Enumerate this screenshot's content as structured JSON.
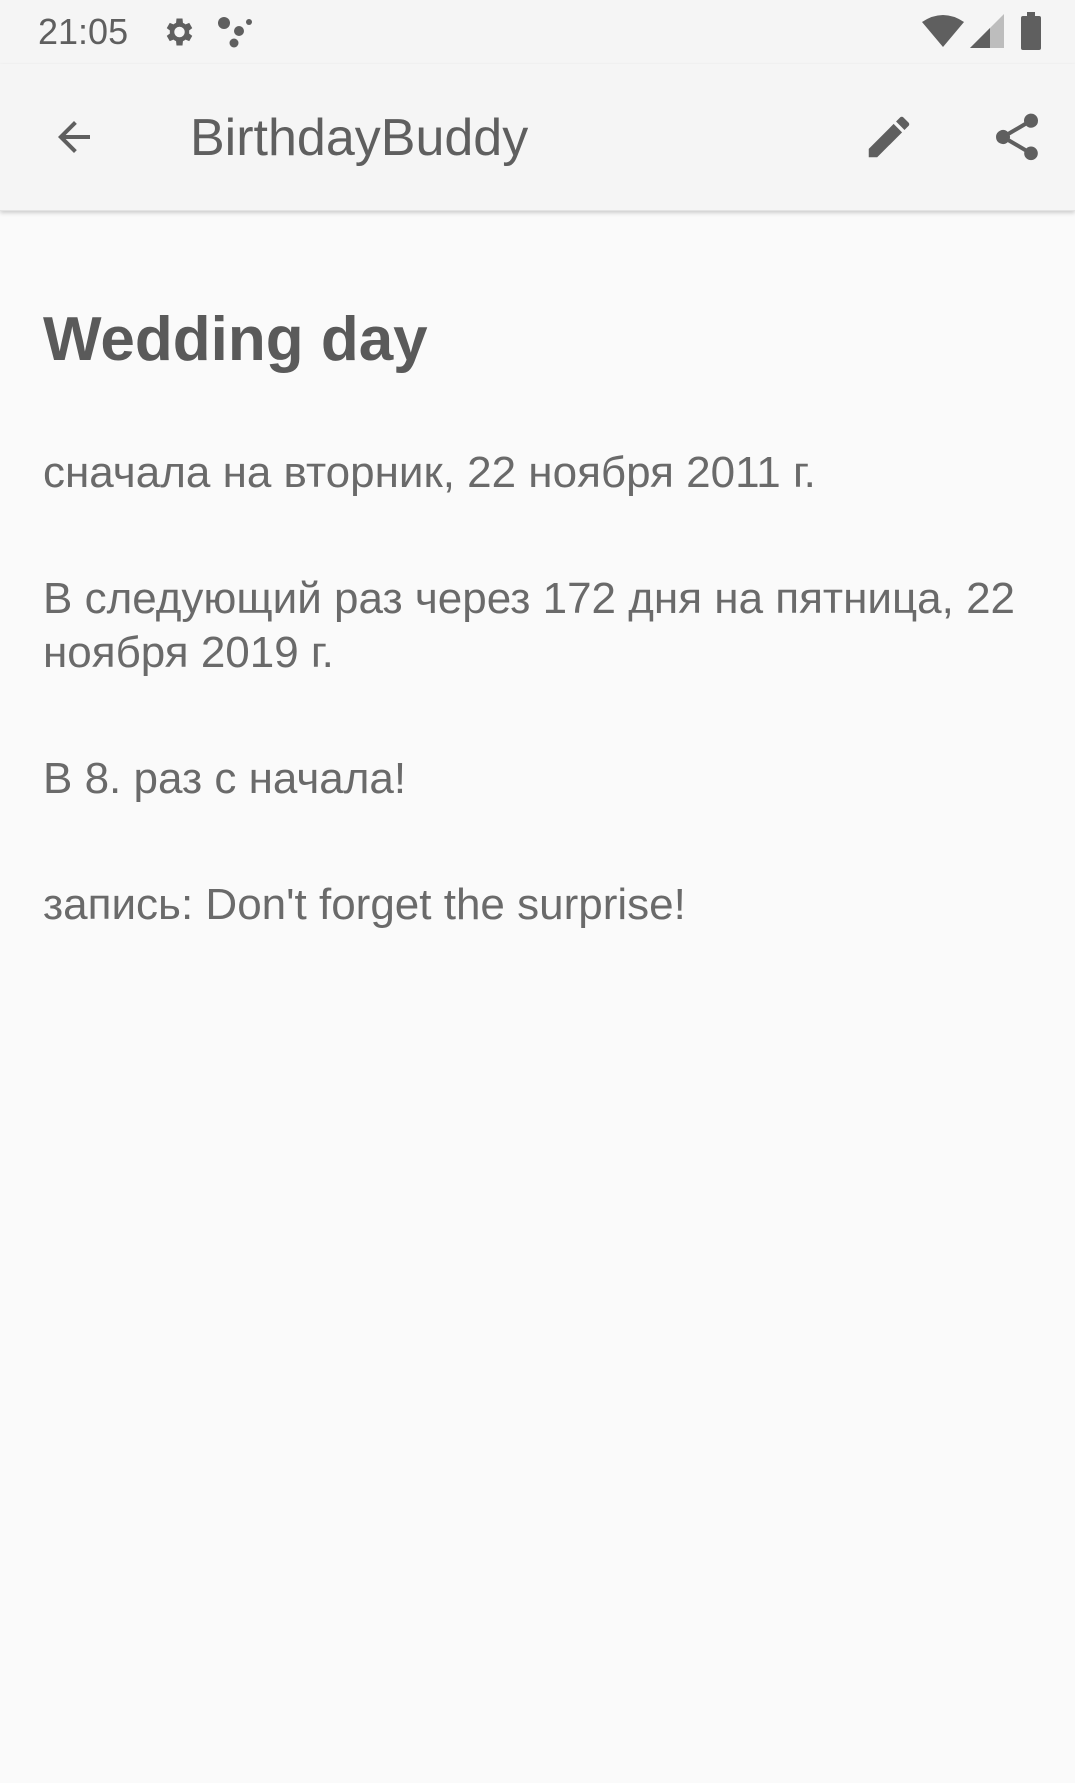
{
  "status_bar": {
    "time": "21:05",
    "icons": [
      "gear-icon",
      "assistant-dots-icon",
      "wifi-icon",
      "signal-icon",
      "battery-icon"
    ]
  },
  "app_bar": {
    "title": "BirthdayBuddy",
    "back_icon": "arrow-back-icon",
    "edit_icon": "pencil-icon",
    "share_icon": "share-icon"
  },
  "event": {
    "title": "Wedding day",
    "first_occurrence": "сначала на вторник, 22 ноября 2011 г.",
    "next_occurrence": "В следующий раз через 172 дня на пятница, 22 ноября 2019 г.",
    "count": "В 8. раз с начала!",
    "note": "запись: Don't forget the surprise!"
  },
  "colors": {
    "background": "#fafafa",
    "app_bar": "#f5f5f5",
    "text": "#666666",
    "icon": "#5f5f5f"
  }
}
